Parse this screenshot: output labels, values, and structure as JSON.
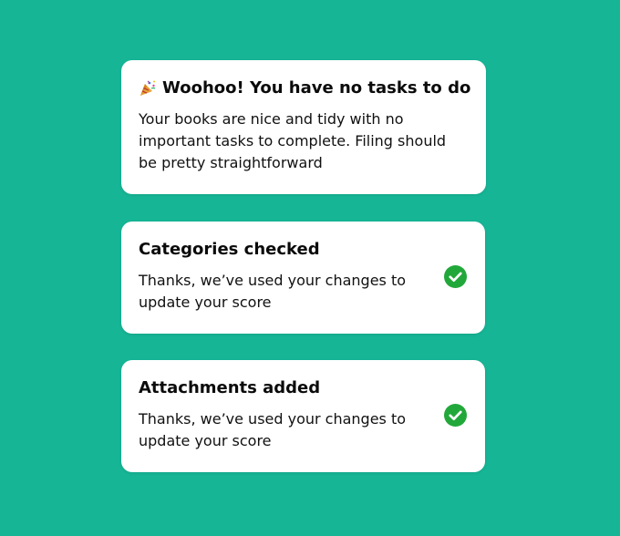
{
  "cards": [
    {
      "title": "Woohoo! You have no tasks to do",
      "body": "Your books are nice and tidy with no important tasks to complete. Filing should be pretty straightforward",
      "icon": "party-popper-icon"
    },
    {
      "title": "Categories checked",
      "body": "Thanks, we’ve used your changes to update your score",
      "icon": "checkmark-circle-icon"
    },
    {
      "title": "Attachments added",
      "body": "Thanks, we’ve used your changes to update your score",
      "icon": "checkmark-circle-icon"
    }
  ],
  "colors": {
    "background": "#16b596",
    "card": "#ffffff",
    "check": "#22a83a"
  }
}
